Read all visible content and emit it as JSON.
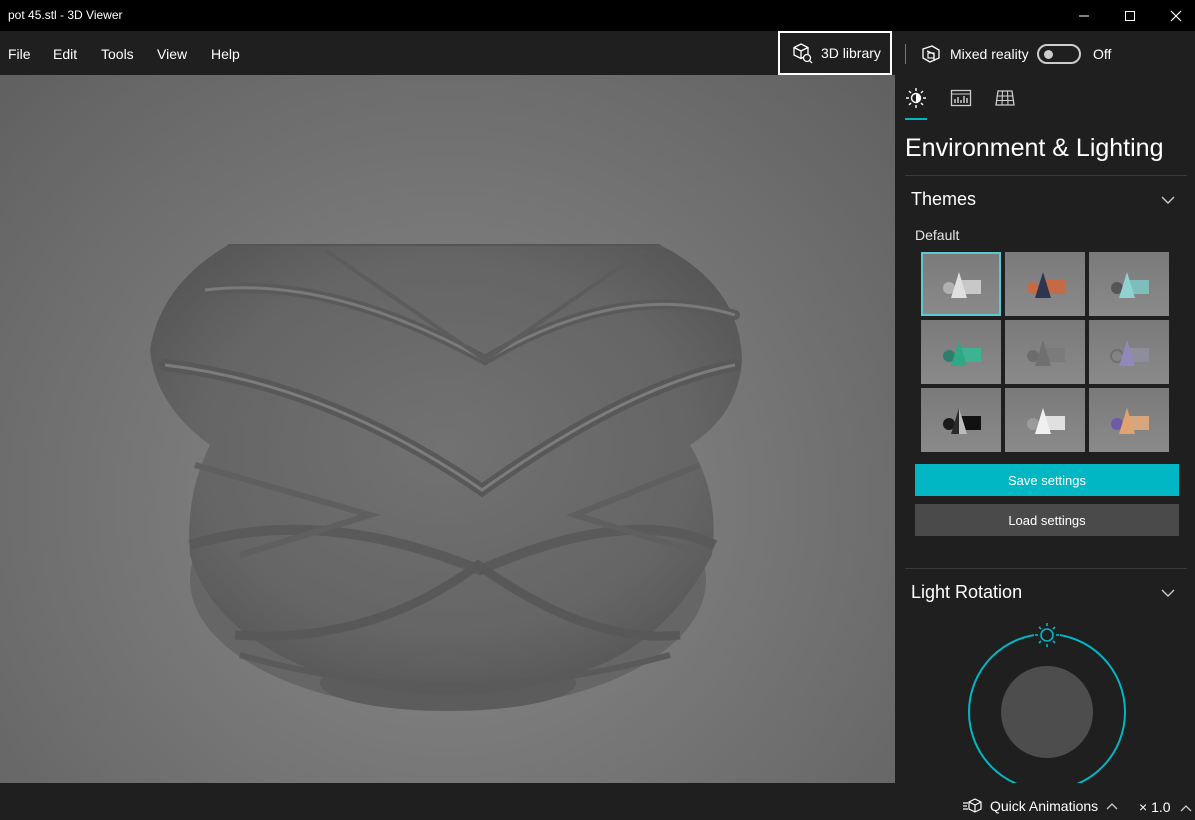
{
  "window": {
    "title": "pot 45.stl - 3D Viewer"
  },
  "menu": {
    "items": [
      "File",
      "Edit",
      "Tools",
      "View",
      "Help"
    ]
  },
  "toolbar": {
    "library_label": "3D library",
    "mixed_reality_label": "Mixed reality",
    "mixed_reality_state": "Off"
  },
  "panel": {
    "tabs": [
      "lighting-tab-icon",
      "stats-tab-icon",
      "grid-tab-icon"
    ],
    "title": "Environment & Lighting",
    "themes": {
      "heading": "Themes",
      "subheading": "Default",
      "selected_index": 0
    },
    "save_label": "Save settings",
    "load_label": "Load settings",
    "light_rotation_heading": "Light Rotation"
  },
  "status": {
    "quick_animations_label": "Quick Animations",
    "speed_label": "× 1.0"
  },
  "colors": {
    "accent": "#00b7c3",
    "background": "#1f1f1f",
    "titlebar": "#000000"
  }
}
